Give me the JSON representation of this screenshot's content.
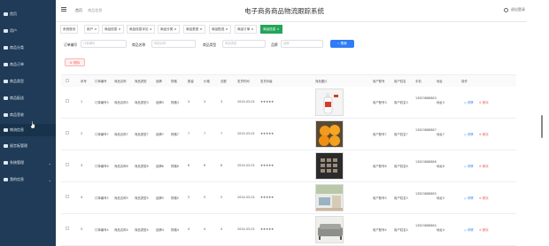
{
  "sidebar": {
    "items": [
      {
        "label": "首页",
        "icon": "home-icon"
      },
      {
        "label": "用户",
        "icon": "user-icon"
      },
      {
        "label": "商品分类",
        "icon": "category-icon"
      },
      {
        "label": "商品订单",
        "icon": "order-icon"
      },
      {
        "label": "商品类型",
        "icon": "type-icon"
      },
      {
        "label": "商品配送",
        "icon": "delivery-icon"
      },
      {
        "label": "商品签收",
        "icon": "sign-icon"
      },
      {
        "label": "物流信息",
        "icon": "logistics-icon"
      },
      {
        "label": "留言板管理",
        "icon": "message-icon"
      },
      {
        "label": "系统管理",
        "icon": "system-icon"
      },
      {
        "label": "我的信息",
        "icon": "profile-icon"
      }
    ]
  },
  "header": {
    "breadcrumb_home": "首页",
    "breadcrumb_current": "商品信息",
    "title": "电子商务商品物流跟踪系统",
    "logout": "退出登录"
  },
  "tabs": [
    {
      "label": "系统首页"
    },
    {
      "label": "用户 ×"
    },
    {
      "label": "商品信息 ×"
    },
    {
      "label": "商品信息评论 ×"
    },
    {
      "label": "商品分类 ×"
    },
    {
      "label": "商品类型 ×"
    },
    {
      "label": "商品配送 ×"
    },
    {
      "label": "商品订单 ×"
    },
    {
      "label": "商品信息 ×"
    }
  ],
  "search": {
    "order_label": "订单编号",
    "order_placeholder": "订单编号",
    "name_label": "商品名称",
    "name_placeholder": "商品名称",
    "type_label": "商品类型",
    "type_placeholder": "商品类型",
    "brand_label": "品牌",
    "brand_placeholder": "品牌",
    "search_button": "搜索"
  },
  "delete_button": "删除",
  "table": {
    "headers": [
      "序号",
      "订单编号",
      "商品名称",
      "商品类型",
      "品牌",
      "规格",
      "数量",
      "价格",
      "总额",
      "发货时间",
      "发货评级",
      "商品图片",
      "用户账号",
      "用户姓名",
      "手机",
      "地址",
      "操作"
    ],
    "rows": [
      {
        "no": "1",
        "order": "订单编号3",
        "name": "商品名称3",
        "type": "商品类型3",
        "brand": "品牌3",
        "spec": "规格3",
        "qty": "3",
        "price": "3",
        "total": "3",
        "date": "2024-03-02",
        "rating": "★★★★★",
        "user": "用户账号3",
        "uname": "用户姓名3",
        "phone": "13823888883",
        "addr": "地址3",
        "image": "bottle"
      },
      {
        "no": "2",
        "order": "订单编号7",
        "name": "商品名称7",
        "type": "商品类型7",
        "brand": "品牌7",
        "spec": "规格7",
        "qty": "7",
        "price": "7",
        "total": "7",
        "date": "2024-03-02",
        "rating": "★★★★★",
        "user": "用户账号7",
        "uname": "用户姓名7",
        "phone": "13823888887",
        "addr": "地址7",
        "image": "oranges"
      },
      {
        "no": "3",
        "order": "订单编号6",
        "name": "商品名称6",
        "type": "商品类型6",
        "brand": "品牌6",
        "spec": "规格6",
        "qty": "6",
        "price": "6",
        "total": "6",
        "date": "2024-03-02",
        "rating": "★★★★★",
        "user": "用户账号6",
        "uname": "用户姓名6",
        "phone": "13823888886",
        "addr": "地址6",
        "image": "keypad"
      },
      {
        "no": "4",
        "order": "订单编号5",
        "name": "商品名称5",
        "type": "商品类型5",
        "brand": "品牌5",
        "spec": "规格5",
        "qty": "5",
        "price": "5",
        "total": "5",
        "date": "2024-03-02",
        "rating": "★★★★★",
        "user": "用户账号5",
        "uname": "用户姓名5",
        "phone": "13823888885",
        "addr": "地址5",
        "image": "room"
      },
      {
        "no": "5",
        "order": "订单编号4",
        "name": "商品名称4",
        "type": "商品类型4",
        "brand": "品牌4",
        "spec": "规格4",
        "qty": "4",
        "price": "4",
        "total": "4",
        "date": "2024-03-02",
        "rating": "★★★★★",
        "user": "用户账号4",
        "uname": "用户姓名4",
        "phone": "13823888884",
        "addr": "地址4",
        "image": "sofa"
      }
    ],
    "detail_label": "详情",
    "delete_label": "删除"
  }
}
